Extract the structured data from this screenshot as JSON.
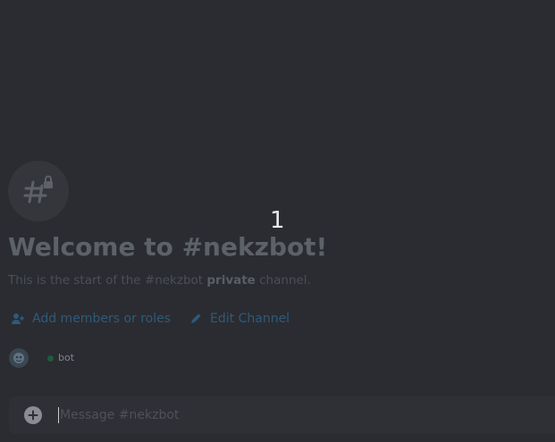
{
  "channel": {
    "name": "#nekzbot",
    "icon": "hash-lock-icon"
  },
  "overlay": {
    "step_number": "1"
  },
  "welcome": {
    "title": "Welcome to #nekzbot!",
    "subtitle_prefix": "This is the start of the #nekzbot ",
    "subtitle_bold": "private",
    "subtitle_suffix": " channel."
  },
  "actions": [
    {
      "label": "Add members or roles",
      "icon": "add-member-icon"
    },
    {
      "label": "Edit Channel",
      "icon": "pencil-icon"
    }
  ],
  "member": {
    "name": "bot",
    "status": "online",
    "status_color": "#23a559"
  },
  "composer": {
    "placeholder": "Message #nekzbot",
    "value": "",
    "add_icon": "plus-circle-icon"
  },
  "colors": {
    "background": "#2b2d31",
    "link": "#00a8fc"
  }
}
